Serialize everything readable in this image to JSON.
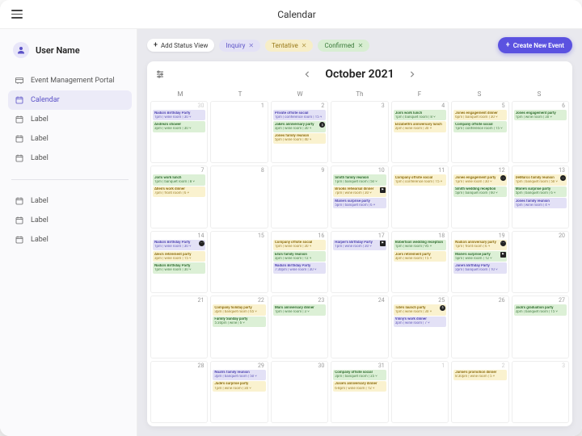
{
  "appTitle": "Calendar",
  "user": {
    "name": "User Name"
  },
  "nav": {
    "items": [
      {
        "label": "Event Management Portal"
      },
      {
        "label": "Calendar",
        "active": true
      },
      {
        "label": "Label"
      },
      {
        "label": "Label"
      },
      {
        "label": "Label"
      }
    ],
    "secondary": [
      {
        "label": "Label"
      },
      {
        "label": "Label"
      },
      {
        "label": "Label"
      }
    ]
  },
  "toolbar": {
    "addStatus": "Add Status View",
    "filters": [
      {
        "label": "Inquiry",
        "kind": "inquiry"
      },
      {
        "label": "Tentative",
        "kind": "tentative"
      },
      {
        "label": "Confirmed",
        "kind": "confirmed"
      }
    ],
    "createEvent": "Create New Event"
  },
  "calendar": {
    "title": "October 2021",
    "dow": [
      "M",
      "T",
      "W",
      "Th",
      "F",
      "S",
      "S"
    ],
    "cells": [
      {
        "n": "30",
        "muted": true,
        "events": [
          {
            "k": "inquiry",
            "t": "Nadia's Birthday Party",
            "d": "1pm | wine room | 30 ⑂"
          },
          {
            "k": "confirmed",
            "t": "Andrea's shower",
            "d": "3pm | wine room | 30 ⑂"
          }
        ]
      },
      {
        "n": "1",
        "events": []
      },
      {
        "n": "2",
        "events": [
          {
            "k": "inquiry",
            "t": "Private offsite social",
            "d": "1pm | conference room | 15 ⑂"
          },
          {
            "k": "confirmed",
            "t": "Jake's anniversary party",
            "d": "3pm | wine room | 30 ⑂",
            "badge": "$"
          },
          {
            "k": "tentative",
            "t": "Jones family reunion",
            "d": "5pm | wine room | 40 ⑂"
          }
        ]
      },
      {
        "n": "3",
        "events": []
      },
      {
        "n": "4",
        "events": [
          {
            "k": "confirmed",
            "t": "Jon's work lunch",
            "d": "1pm | banquet room | 8 ⑂"
          },
          {
            "k": "tentative",
            "t": "Elizabeth's anniversary lunch",
            "d": "2pm | wine room | 30 ⑂"
          }
        ]
      },
      {
        "n": "5",
        "events": [
          {
            "k": "tentative",
            "t": "Jones engagement dinner",
            "d": "6pm | banquet room | 30 ⑂"
          },
          {
            "k": "confirmed",
            "t": "Company offsite social",
            "d": "1pm | conference room | 15 ⑂"
          }
        ]
      },
      {
        "n": "6",
        "events": [
          {
            "k": "confirmed",
            "t": "Jones engagement party",
            "d": "1pm | wine room | 30 ⑂"
          }
        ]
      },
      {
        "n": "7",
        "events": [
          {
            "k": "confirmed",
            "t": "Jon's work lunch",
            "d": "1pm | banquet room | 8 ⑂"
          },
          {
            "k": "tentative",
            "t": "Allen's work dinner",
            "d": "7pm | front room | 6 ⑂"
          }
        ]
      },
      {
        "n": "8",
        "events": []
      },
      {
        "n": "9",
        "events": []
      },
      {
        "n": "10",
        "events": [
          {
            "k": "confirmed",
            "t": "Smith family reunion",
            "d": "1pm | banquet room | 50 ⑂"
          },
          {
            "k": "tentative",
            "t": "Brooks rehearsal dinner",
            "d": "7pm | wine room | 30 ⑂",
            "badge": "f"
          },
          {
            "k": "inquiry",
            "t": "Marie's surprise party",
            "d": "5pm | banquet room | 6 ⑂"
          }
        ]
      },
      {
        "n": "11",
        "events": [
          {
            "k": "tentative",
            "t": "Company offsite social",
            "d": "1pm | conference room | 15 ⑂"
          }
        ]
      },
      {
        "n": "12",
        "events": [
          {
            "k": "tentative",
            "t": "Jones engagement party",
            "d": "1pm | wine room | 30 ⑂",
            "badge": "m"
          },
          {
            "k": "confirmed",
            "t": "Smith wedding reception",
            "d": "5pm | banquet room | 60 ⑂"
          }
        ]
      },
      {
        "n": "13",
        "events": [
          {
            "k": "tentative",
            "t": "DeMarco family reunion",
            "d": "1pm | banquet room | 50 ⑂",
            "badge": "m"
          },
          {
            "k": "confirmed",
            "t": "Marie's surprise party",
            "d": "5pm | banquet room | 6 ⑂"
          },
          {
            "k": "inquiry",
            "t": "Jones family reunion",
            "d": "1pm | wine room | 4 ⑂"
          }
        ]
      },
      {
        "n": "14",
        "events": [
          {
            "k": "inquiry",
            "t": "Nadia's Birthday Party",
            "d": "1pm | wine room | 30 ⑂",
            "badge": "m"
          },
          {
            "k": "tentative",
            "t": "Alex's retirement party",
            "d": "3pm | wine room | 15 ⑂"
          },
          {
            "k": "confirmed",
            "t": "Nadia's Birthday Party",
            "d": "1pm | wine room | 30 ⑂"
          }
        ]
      },
      {
        "n": "15",
        "events": []
      },
      {
        "n": "16",
        "events": [
          {
            "k": "tentative",
            "t": "Company offsite social",
            "d": "1pm | wine room | 30 ⑂"
          },
          {
            "k": "confirmed",
            "t": "Ella's family reunion",
            "d": "3pm | wine room | 12 ⑂"
          },
          {
            "k": "inquiry",
            "t": "Nadia's Birthday Party",
            "d": "7:30pm | wine room | 30 ⑂"
          }
        ]
      },
      {
        "n": "17",
        "events": [
          {
            "k": "inquiry",
            "t": "Harper's Birthday Party",
            "d": "1pm | wine room | 30 ⑂",
            "badge": "f"
          }
        ]
      },
      {
        "n": "18",
        "events": [
          {
            "k": "confirmed",
            "t": "Robertson wedding reception",
            "d": "1pm | wine room | 95 ⑂"
          },
          {
            "k": "tentative",
            "t": "Joe's retirement party",
            "d": "3pm | wine room | 15 ⑂"
          }
        ]
      },
      {
        "n": "19",
        "events": [
          {
            "k": "tentative",
            "t": "Nadia's anniversary party",
            "d": "1pm | front room | 6 ⑂",
            "badge": "m"
          },
          {
            "k": "confirmed",
            "t": "Marie's surprise party",
            "d": "5pm | wine room | 12 ⑂",
            "badge": "f"
          },
          {
            "k": "inquiry",
            "t": "Jane's Birthday Party",
            "d": "2pm | banquet room | 10 ⑂"
          }
        ]
      },
      {
        "n": "20",
        "events": []
      },
      {
        "n": "21",
        "events": []
      },
      {
        "n": "22",
        "events": [
          {
            "k": "tentative",
            "t": "Company holiday party",
            "d": "3pm | banquet room | 65 ⑂"
          },
          {
            "k": "confirmed",
            "t": "Family Sunday party",
            "d": "5:30pm | wine | 6 ⑂"
          }
        ]
      },
      {
        "n": "23",
        "events": [
          {
            "k": "confirmed",
            "t": "Mai's anniversary dinner",
            "d": "1pm | wine room | 3 ⑂"
          }
        ]
      },
      {
        "n": "24",
        "events": []
      },
      {
        "n": "25",
        "events": [
          {
            "k": "tentative",
            "t": "Tate's launch party",
            "d": "1pm | wine room | 30 ⑂",
            "badge": "$"
          },
          {
            "k": "inquiry",
            "t": "Vinny's work dinner",
            "d": "3pm | wine room | 7 ⑂"
          }
        ]
      },
      {
        "n": "26",
        "events": []
      },
      {
        "n": "27",
        "events": [
          {
            "k": "confirmed",
            "t": "Jack's graduation party",
            "d": "2pm | banquet room | 15 ⑂"
          }
        ]
      },
      {
        "n": "28",
        "events": []
      },
      {
        "n": "29",
        "events": [
          {
            "k": "inquiry",
            "t": "Noah's family reunion",
            "d": "3pm | banquet room | 50 ⑂"
          },
          {
            "k": "tentative",
            "t": "Jade's surprise party",
            "d": "1pm | wine room | 30 ⑂"
          }
        ]
      },
      {
        "n": "30",
        "events": []
      },
      {
        "n": "31",
        "events": [
          {
            "k": "confirmed",
            "t": "Company offsite social",
            "d": "3pm | banquet room | 35 ⑂"
          },
          {
            "k": "tentative",
            "t": "Josie's anniversary dinner",
            "d": "6-8pm | wine room | 12 ⑂"
          }
        ]
      },
      {
        "n": "1",
        "muted": true,
        "events": []
      },
      {
        "n": "2",
        "muted": true,
        "events": [
          {
            "k": "tentative",
            "t": "Jamie's promotion dinner",
            "d": "8:30pm | wine room | 5 ⑂"
          }
        ]
      },
      {
        "n": "3",
        "muted": true,
        "events": []
      }
    ]
  }
}
